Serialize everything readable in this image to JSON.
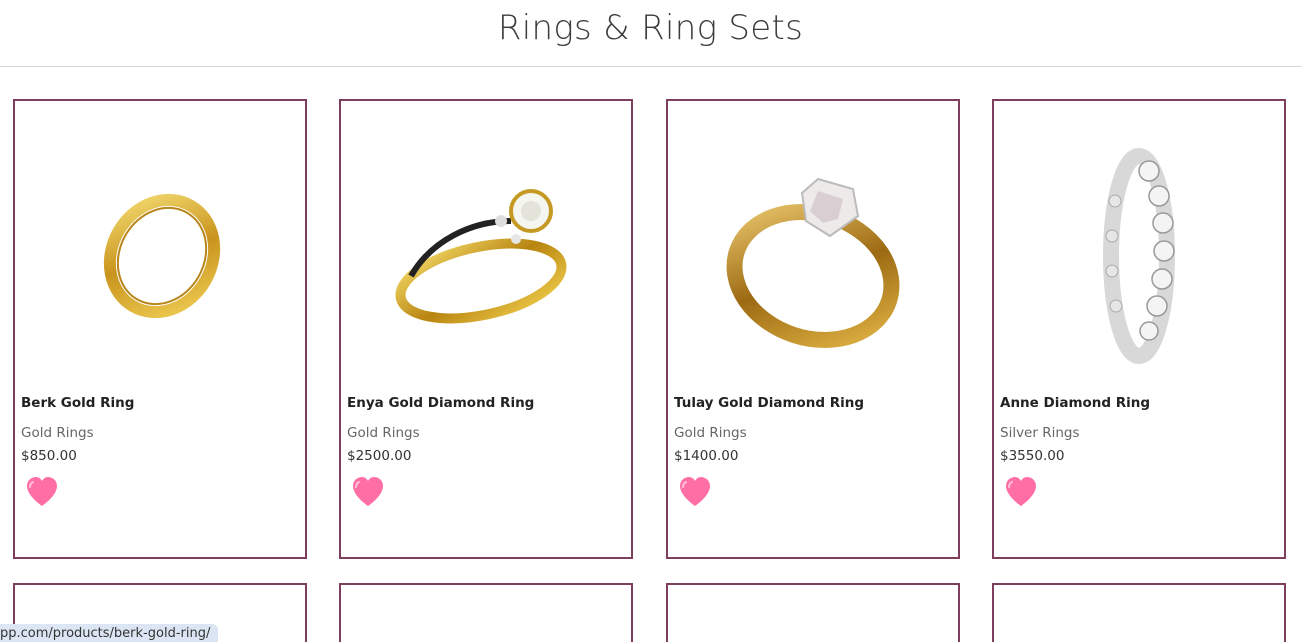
{
  "header": {
    "title": "Rings & Ring Sets"
  },
  "products": [
    {
      "name": "Berk Gold Ring",
      "category": "Gold Rings",
      "price": "$850.00",
      "image": "gold-band-ring"
    },
    {
      "name": "Enya Gold Diamond Ring",
      "category": "Gold Rings",
      "price": "$2500.00",
      "image": "gold-diamond-engagement-ring"
    },
    {
      "name": "Tulay Gold Diamond Ring",
      "category": "Gold Rings",
      "price": "$1400.00",
      "image": "gold-solitaire-diamond-ring"
    },
    {
      "name": "Anne Diamond Ring",
      "category": "Silver Rings",
      "price": "$3550.00",
      "image": "silver-diamond-eternity-ring"
    }
  ],
  "favorite_icon": "heart-icon",
  "colors": {
    "card_border": "#7e3f5f",
    "heart": "#ff6fa5",
    "status_bar": "#dbe5f3"
  },
  "status_bar": {
    "url": "pp.com/products/berk-gold-ring/"
  }
}
